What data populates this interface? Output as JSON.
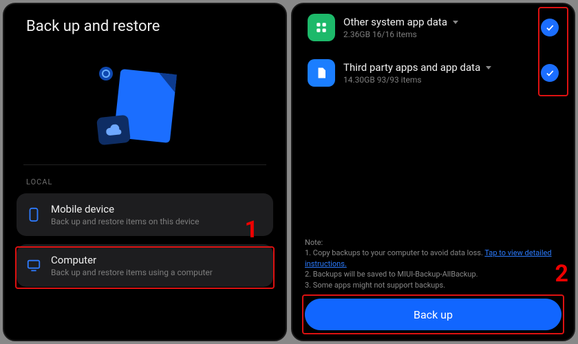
{
  "left": {
    "title": "Back up and restore",
    "section_label": "LOCAL",
    "options": [
      {
        "title": "Mobile device",
        "subtitle": "Back up and restore items on this device"
      },
      {
        "title": "Computer",
        "subtitle": "Back up and restore items using a computer"
      }
    ],
    "step_number": "1"
  },
  "right": {
    "rows": [
      {
        "title": "Other system app data",
        "subtitle": "2.36GB  16/16 items"
      },
      {
        "title": "Third party apps and app data",
        "subtitle": "14.30GB  93/93 items"
      }
    ],
    "note_label": "Note:",
    "note_1_a": "1. Copy backups to your computer to avoid data loss. ",
    "note_1_link": "Tap to view detailed instructions.",
    "note_2": "2. Backups will be saved to MIUI-Backup-AllBackup.",
    "note_3": "3. Some apps might not support backups.",
    "button": "Back up",
    "step_number": "2"
  }
}
